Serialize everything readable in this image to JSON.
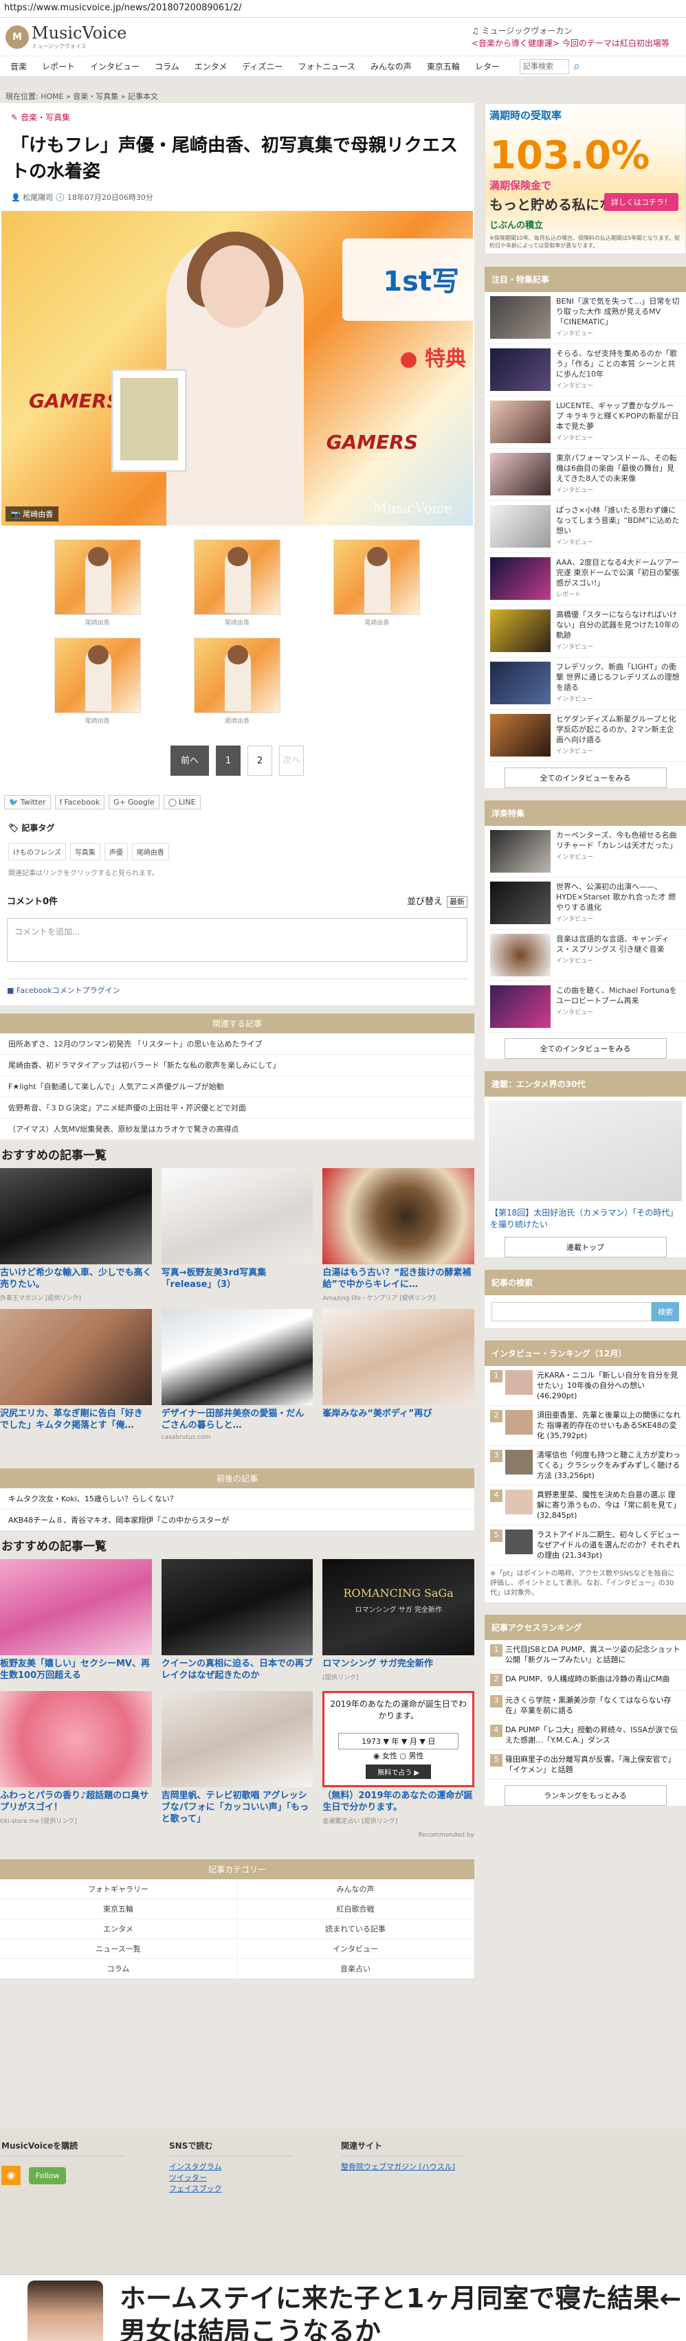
{
  "url": "https://www.musicvoice.jp/news/20180720089061/2/",
  "logo": {
    "mark": "M",
    "name": "MusicVoice",
    "sub": "ミュージックヴォイス"
  },
  "top_notice": {
    "line1": "♫ ミュージックヴォーカン",
    "line2": "<音楽から導く健康運> 今回のテーマは紅白初出場等"
  },
  "nav": [
    "音楽",
    "レポート",
    "インタビュー",
    "コラム",
    "エンタメ",
    "ディズニー",
    "フォトニュース",
    "みんなの声",
    "東京五輪",
    "レター"
  ],
  "search": {
    "placeholder": "記事検索"
  },
  "breadcrumb": "現在位置: HOME » 音楽・写真集 » 記事本文",
  "article": {
    "category": "音楽・写真集",
    "title": "「けもフレ」声優・尾崎由香、初写真集で母親リクエストの水着姿",
    "author": "松尾陽司",
    "date": "18年07月20日06時30分",
    "photo_credit": "尾崎由香",
    "watermark": "MusicVoice",
    "banner_text": "1st写",
    "banner_red": "● 特典",
    "gamers": "GAMERS",
    "thumb_caption": "尾崎由香"
  },
  "pager": {
    "prev": "前へ",
    "pages": [
      "1",
      "2"
    ],
    "next": "次へ"
  },
  "share": [
    "Twitter",
    "Facebook",
    "Google",
    "LINE"
  ],
  "tags": {
    "heading": "記事タグ",
    "items": [
      "けものフレンズ",
      "写真集",
      "声優",
      "尾崎由香"
    ],
    "note": "関連記事はリンクをクリックすると見られます。"
  },
  "comments": {
    "count": "コメント0件",
    "sort_label": "並び替え",
    "sort_value": "最新",
    "placeholder": "コメントを追加...",
    "plugin": "Facebookコメントプラグイン"
  },
  "related": {
    "heading": "関連する記事",
    "items": [
      "田所あずさ、12月のワンマン初発売 「リスタート」の思いを込めたライブ",
      "尾崎由香、初ドラマタイアップは初バラード「新たな私の歌声を楽しみにして」",
      "F★light「自動通して楽しんで」人気アニメ声優グループが始動",
      "佐野希音、「３ＤＧ決定」アニメ総声優の上田壮平・芹沢優とどで対面",
      "（アイマス）人気MV総集発表、原紗友里はカラオケで驚きの高得点"
    ]
  },
  "rec1": {
    "heading": "おすすめの記事一覧",
    "items": [
      {
        "cap": "古いけど希少な輸入車、少しでも高く売りたい。",
        "src": "外車王マガジン [提供リンク]"
      },
      {
        "cap": "写真→板野友美3rd写真集「release」（3）",
        "src": ""
      },
      {
        "cap": "白湯はもう古い？“起き抜けの酵素補給”で中からキレイに…",
        "src": "Amazing life・ケンプリア [提供リンク]"
      },
      {
        "cap": "沢尻エリカ、革なぎ剛に告白「好きでした」キムタク掲落とす「俺…",
        "src": ""
      },
      {
        "cap": "デザイナー田部井美奈の愛猫・だんごさんの暮らしと…",
        "src": "casabrutus.com"
      },
      {
        "cap": "峯岸みなみ“美ボディ”再び",
        "src": ""
      }
    ]
  },
  "prevnext": {
    "heading": "前後の記事",
    "items": [
      "キムタク次女・Koki、15歳らしい？らしくない？",
      "AKB48チーム８、青谷マキオ、岡本家翔伊「この中からスターが"
    ]
  },
  "rec2": {
    "heading": "おすすめの記事一覧",
    "items": [
      {
        "cap": "板野友美「嬉しい」セクシーMV、再生数100万回超える",
        "src": ""
      },
      {
        "cap": "クイーンの真相に迫る、日本での再ブレイクはなぜ起きたのか",
        "src": ""
      },
      {
        "cap": "ロマンシング サガ完全新作",
        "src": "[提供リンク]"
      },
      {
        "cap": "ふわっとパラの香り♪超話題のロ臭サプリがスゴイ！",
        "src": "tiki-store.me [提供リンク]"
      },
      {
        "cap": "吉岡里帆、テレビ初歌唱 アグレッシブなパフォに「カッコいい声」「もっと歌って」",
        "src": ""
      },
      {
        "cap": "（無料）2019年のあなたの運命が誕生日で分かります。",
        "src": "金運鑑定占い [提供リンク]"
      }
    ],
    "saga_title": "ROMANCING SaGa",
    "saga_sub": "ロマンシング サガ 完全新作",
    "calendar_text": "2019年のあなたの運命が誕生日でわかります。",
    "calendar_year": "1973 ▼ 年 ▼ 月 ▼ 日",
    "calendar_gender": "◉ 女性 ○ 男性",
    "calendar_btn": "無料で占う ▶",
    "recommended": "Recommended by"
  },
  "categories": {
    "heading": "記事カテゴリー",
    "items": [
      "フォトギャラリー",
      "みんなの声",
      "東京五輪",
      "紅白歌合戦",
      "エンタメ",
      "読まれている記事",
      "ニュース一覧",
      "インタビュー",
      "コラム",
      "音楽占い"
    ]
  },
  "sidebar": {
    "ad": {
      "l1": "満期時の受取率",
      "big": "103.0%",
      "l2": "満期保険金で",
      "l3": "もっと貯める私になる!",
      "btn": "詳しくはコチラ！",
      "brand": "じぶんの積立",
      "small": "※保険期間10年、毎月払込の場合。保険料の払込期間は5年間となります。契約日や年齢によっては受取率が異なります。"
    },
    "featured": {
      "heading": "注目・特集記事",
      "items": [
        {
          "t": "BENI「涙で気を失って…」日常を切り取った大作 成熟が見えるMV「CINEMATIC」",
          "s": "インタビュー"
        },
        {
          "t": "そらる、なぜ支持を集めるのか「歌う」「作る」ことの本質 シーンと共に歩んだ10年",
          "s": "インタビュー"
        },
        {
          "t": "LUCENTE、ギャップ豊かなグループ キラキラと輝くK-POPの新星が日本で見た夢",
          "s": "インタビュー"
        },
        {
          "t": "東京パフォーマンスドール、その転機は6曲目の楽曲「最後の舞台」見えてきた8人での未来像",
          "s": "インタビュー"
        },
        {
          "t": "ぱっさ×小林「誰いたる思わず嫌になってしまう音楽」“BDM”に込めた想い",
          "s": "インタビュー"
        },
        {
          "t": "AAA、2度目となる4大ドームツアー完遂 東京ドームで公演「初日の緊張感がスゴい!」",
          "s": "レポート"
        },
        {
          "t": "高橋優「スターにならなければいけない」自分の武器を見つけた10年の軌跡",
          "s": "インタビュー"
        },
        {
          "t": "フレデリック、新曲「LIGHT」の衝撃 世界に通じるフレデリズムの理想を語る",
          "s": "インタビュー"
        },
        {
          "t": "ヒゲダンディズム新星グループと化学反応が起こるのか、2マン新主企画へ向け語る",
          "s": "インタビュー"
        }
      ],
      "more": "全てのインタビューをみる"
    },
    "western": {
      "heading": "洋楽特集",
      "items": [
        {
          "t": "カーペンターズ、今も色褪せる名曲 リチャード「カレンは天才だった」",
          "s": "インタビュー"
        },
        {
          "t": "世界へ、公演初の出演へ——、HYDE×Starset 歌かれ合った才 燃やりする進化",
          "s": "インタビュー"
        },
        {
          "t": "音楽は言語的な言語、キャンディス・スプリングス 引き継ぐ音楽",
          "s": "インタビュー"
        },
        {
          "t": "この曲を聴く、Michael Fortunaを ユーロビートブーム再来",
          "s": "インタビュー"
        }
      ],
      "more": "全てのインタビューをみる"
    },
    "serial": {
      "heading": "連載：エンタメ界の30代",
      "caption": "【第18回】太田好治氏（カメラマン）「その時代」を撮り続けたい",
      "more": "連載トップ"
    },
    "search": {
      "heading": "記事の検索",
      "btn": "検索"
    },
    "ranking": {
      "heading": "インタビュー・ランキング（12月）",
      "items": [
        {
          "t": "元KARA・ニコル「新しい自分を自分を見せたい」10年後の自分への想い",
          "v": "(46,290pt)"
        },
        {
          "t": "須田亜香里、先輩と後輩以上の関係になれた 指導者的存在のせいもあるSKE48の変化",
          "v": "(35,792pt)"
        },
        {
          "t": "清塚信也「何度も持つと聴こえ方が変わってくる」クラシックをみずみずしく聴ける方法",
          "v": "(33,256pt)"
        },
        {
          "t": "真野恵里菜、魔性を決めた自意の選ぶ 理解に寄り添うもの、今は「常に前を見て」",
          "v": "(32,845pt)"
        },
        {
          "t": "ラストアイドル二期生、初々しくデビュー なぜアイドルの道を選んだのか？それぞれの理由",
          "v": "(21,343pt)"
        }
      ],
      "note": "※「pt」はポイントの略称。アクセス数やSNSなどを独自に評価し、ポイントとして表示。なお、「インタビュー」の30代」は対象外。"
    },
    "access": {
      "heading": "記事アクセスランキング",
      "items": [
        "三代目JSBとDA PUMP、異スーツ姿の記念ショット公開「新グループみたい」と話題に",
        "DA PUMP、9人構成時の新曲は冷静の青山CM曲",
        "元きくら学院・黒瀬美沙奈「なくてはならない存在」卒業を前に語る",
        "DA PUMP「レコ大」授動の昇続々、ISSAが涙で伝えた感謝…「Y.M.C.A.」ダンス",
        "篠田麻里子の出分離写真が反響。「海上保安官で」「イケメン」と話題"
      ],
      "more": "ランキングをもっとみる"
    }
  },
  "footer": {
    "col1": "MusicVoiceを購読",
    "follow": "Follow",
    "col2": "SNSで読む",
    "sns": [
      "インスタグラム",
      "ツイッター",
      "フェイスブック"
    ],
    "col3": "関連サイト",
    "sites": [
      "整骨院ウェブマガジン [ハウスル]"
    ]
  },
  "bottom_ad": {
    "line1": "ホームステイに来た子と1ヶ月同室で寝た結果←",
    "line2": "男女は結局こうなるか"
  }
}
